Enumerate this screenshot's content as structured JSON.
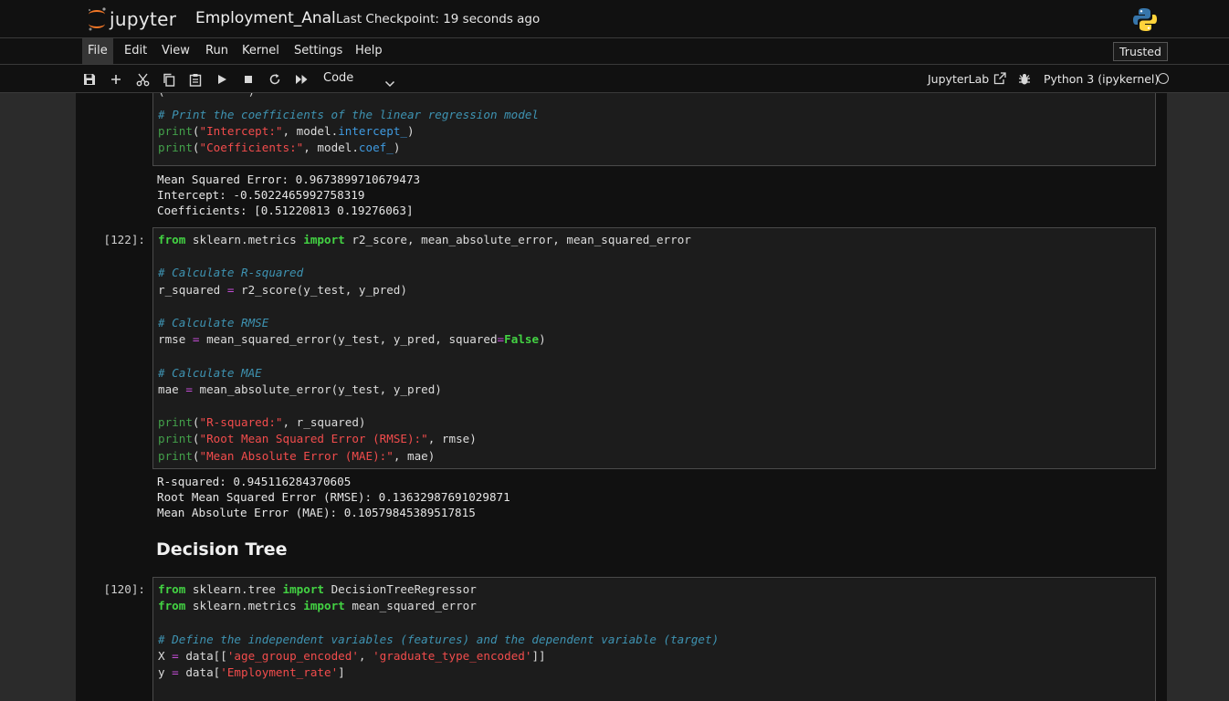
{
  "header": {
    "app_name": "jupyter",
    "notebook_title": "Employment_Anal",
    "checkpoint": "Last Checkpoint: 19 seconds ago"
  },
  "menu": {
    "items": [
      "File",
      "Edit",
      "View",
      "Run",
      "Kernel",
      "Settings",
      "Help"
    ],
    "trusted": "Trusted"
  },
  "toolbar": {
    "cell_type": "Code",
    "jupyterlab_label": "JupyterLab",
    "kernel_name": "Python 3 (ipykernel)",
    "icons": [
      "save-icon",
      "add-cell-icon",
      "cut-icon",
      "copy-icon",
      "paste-icon",
      "run-icon",
      "stop-icon",
      "restart-icon",
      "run-all-icon"
    ]
  },
  "cells": [
    {
      "type": "code",
      "prompt": "",
      "lines": [
        [],
        [
          [
            "cm",
            "# Print the coefficients of the linear regression model"
          ]
        ],
        [
          [
            "bi",
            "print"
          ],
          [
            "pl",
            "("
          ],
          [
            "st",
            "\"Intercept:\""
          ],
          [
            "pl",
            ", model."
          ],
          [
            "at",
            "intercept_"
          ],
          [
            "pl",
            ")"
          ]
        ],
        [
          [
            "bi",
            "print"
          ],
          [
            "pl",
            "("
          ],
          [
            "st",
            "\"Coefficients:\""
          ],
          [
            "pl",
            ", model."
          ],
          [
            "at",
            "coef_"
          ],
          [
            "pl",
            ")"
          ]
        ]
      ],
      "output": [
        "Mean Squared Error: 0.9673899710679473",
        "Intercept: -0.5022465992758319",
        "Coefficients: [0.51220813 0.19276063]"
      ]
    },
    {
      "type": "code",
      "prompt": "[122]:",
      "lines": [
        [
          [
            "kw",
            "from"
          ],
          [
            "pl",
            " sklearn.metrics "
          ],
          [
            "kw",
            "import"
          ],
          [
            "pl",
            " r2_score, mean_absolute_error, mean_squared_error"
          ]
        ],
        [],
        [
          [
            "cm",
            "# Calculate R-squared"
          ]
        ],
        [
          [
            "pl",
            "r_squared "
          ],
          [
            "op",
            "="
          ],
          [
            "pl",
            " r2_score(y_test, y_pred)"
          ]
        ],
        [],
        [
          [
            "cm",
            "# Calculate RMSE"
          ]
        ],
        [
          [
            "pl",
            "rmse "
          ],
          [
            "op",
            "="
          ],
          [
            "pl",
            " mean_squared_error(y_test, y_pred, squared"
          ],
          [
            "op",
            "="
          ],
          [
            "kw",
            "False"
          ],
          [
            "pl",
            ")"
          ]
        ],
        [],
        [
          [
            "cm",
            "# Calculate MAE"
          ]
        ],
        [
          [
            "pl",
            "mae "
          ],
          [
            "op",
            "="
          ],
          [
            "pl",
            " mean_absolute_error(y_test, y_pred)"
          ]
        ],
        [],
        [
          [
            "bi",
            "print"
          ],
          [
            "pl",
            "("
          ],
          [
            "st",
            "\"R-squared:\""
          ],
          [
            "pl",
            ", r_squared)"
          ]
        ],
        [
          [
            "bi",
            "print"
          ],
          [
            "pl",
            "("
          ],
          [
            "st",
            "\"Root Mean Squared Error (RMSE):\""
          ],
          [
            "pl",
            ", rmse)"
          ]
        ],
        [
          [
            "bi",
            "print"
          ],
          [
            "pl",
            "("
          ],
          [
            "st",
            "\"Mean Absolute Error (MAE):\""
          ],
          [
            "pl",
            ", mae)"
          ]
        ]
      ],
      "output": [
        "R-squared: 0.945116284370605",
        "Root Mean Squared Error (RMSE): 0.13632987691029871",
        "Mean Absolute Error (MAE): 0.10579845389517815"
      ]
    },
    {
      "type": "markdown",
      "heading": "Decision Tree"
    },
    {
      "type": "code",
      "prompt": "[120]:",
      "lines": [
        [
          [
            "kw",
            "from"
          ],
          [
            "pl",
            " sklearn.tree "
          ],
          [
            "kw",
            "import"
          ],
          [
            "pl",
            " DecisionTreeRegressor"
          ]
        ],
        [
          [
            "kw",
            "from"
          ],
          [
            "pl",
            " sklearn.metrics "
          ],
          [
            "kw",
            "import"
          ],
          [
            "pl",
            " mean_squared_error"
          ]
        ],
        [],
        [
          [
            "cm",
            "# Define the independent variables (features) and the dependent variable (target)"
          ]
        ],
        [
          [
            "pl",
            "X "
          ],
          [
            "op",
            "="
          ],
          [
            "pl",
            " data[["
          ],
          [
            "st",
            "'age_group_encoded'"
          ],
          [
            "pl",
            ", "
          ],
          [
            "st",
            "'graduate_type_encoded'"
          ],
          [
            "pl",
            "]]"
          ]
        ],
        [
          [
            "pl",
            "y "
          ],
          [
            "op",
            "="
          ],
          [
            "pl",
            " data["
          ],
          [
            "st",
            "'Employment_rate'"
          ],
          [
            "pl",
            "]"
          ]
        ]
      ],
      "output": []
    }
  ],
  "colors": {
    "background": "#111111",
    "keyword": "#43d343",
    "builtin": "#43a04a",
    "string": "#f24c4c",
    "comment": "#3e93b2",
    "operator": "#c44dd6",
    "attribute": "#3f9ae0",
    "logo_orange": "#f37726",
    "python_blue": "#3776ab",
    "python_yellow": "#ffd43b"
  }
}
